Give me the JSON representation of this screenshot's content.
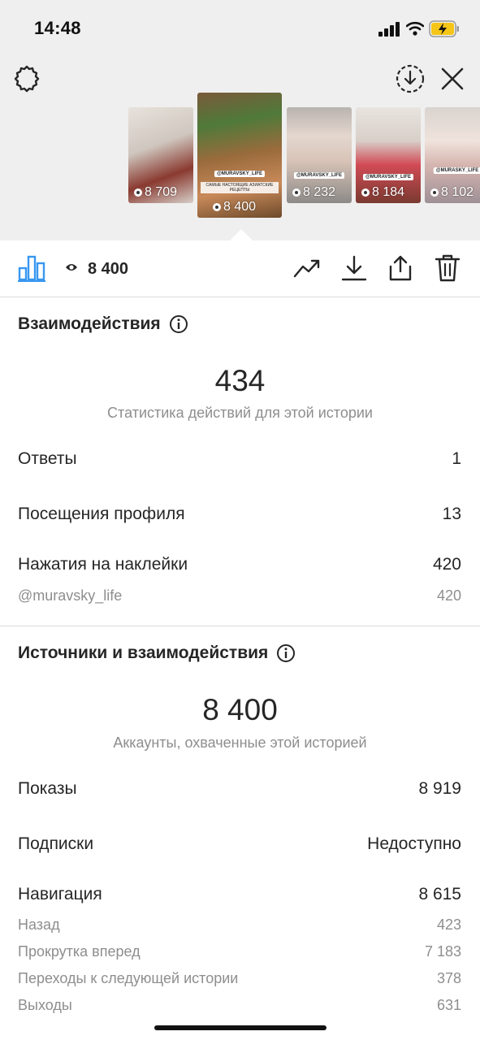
{
  "status_bar": {
    "time": "14:48"
  },
  "thumbnails": [
    {
      "views": "8 709",
      "tag": "",
      "caption": "",
      "accent": "#c7402a"
    },
    {
      "views": "8 400",
      "tag": "@MURAVSKY_LIFE",
      "caption": "САМЫЕ НАСТОЯЩИЕ АЗИАТСКИЕ РЕЦЕПТЫ",
      "accent": "#9a6b3c"
    },
    {
      "views": "8 232",
      "tag": "@MURAVSKY_LIFE",
      "caption": "",
      "accent": "#cfc6c0"
    },
    {
      "views": "8 184",
      "tag": "@MURAVSKY_LIFE",
      "caption": "",
      "accent": "#d14b56"
    },
    {
      "views": "8 102",
      "tag": "@MURASKY_LIFE",
      "caption": "",
      "accent": "#e8dcd8"
    }
  ],
  "toolbar": {
    "views": "8 400"
  },
  "interactions": {
    "title": "Взаимодействия",
    "total": "434",
    "subtitle": "Статистика действий для этой истории",
    "rows": [
      {
        "label": "Ответы",
        "value": "1"
      },
      {
        "label": "Посещения профиля",
        "value": "13"
      },
      {
        "label": "Нажатия на наклейки",
        "value": "420"
      }
    ],
    "sticker_row": {
      "label": "@muravsky_life",
      "value": "420"
    }
  },
  "discovery": {
    "title": "Источники и взаимодействия",
    "total": "8 400",
    "subtitle": "Аккаунты, охваченные этой историей",
    "rows": [
      {
        "label": "Показы",
        "value": "8 919"
      },
      {
        "label": "Подписки",
        "value": "Недоступно"
      },
      {
        "label": "Навигация",
        "value": "8 615"
      }
    ],
    "nav_rows": [
      {
        "label": "Назад",
        "value": "423"
      },
      {
        "label": "Прокрутка вперед",
        "value": "7 183"
      },
      {
        "label": "Переходы к следующей истории",
        "value": "378"
      },
      {
        "label": "Выходы",
        "value": "631"
      }
    ]
  },
  "colors": {
    "accent": "#3897f0",
    "text": "#262626",
    "muted": "#8e8e8e",
    "header_bg": "#efefef"
  }
}
